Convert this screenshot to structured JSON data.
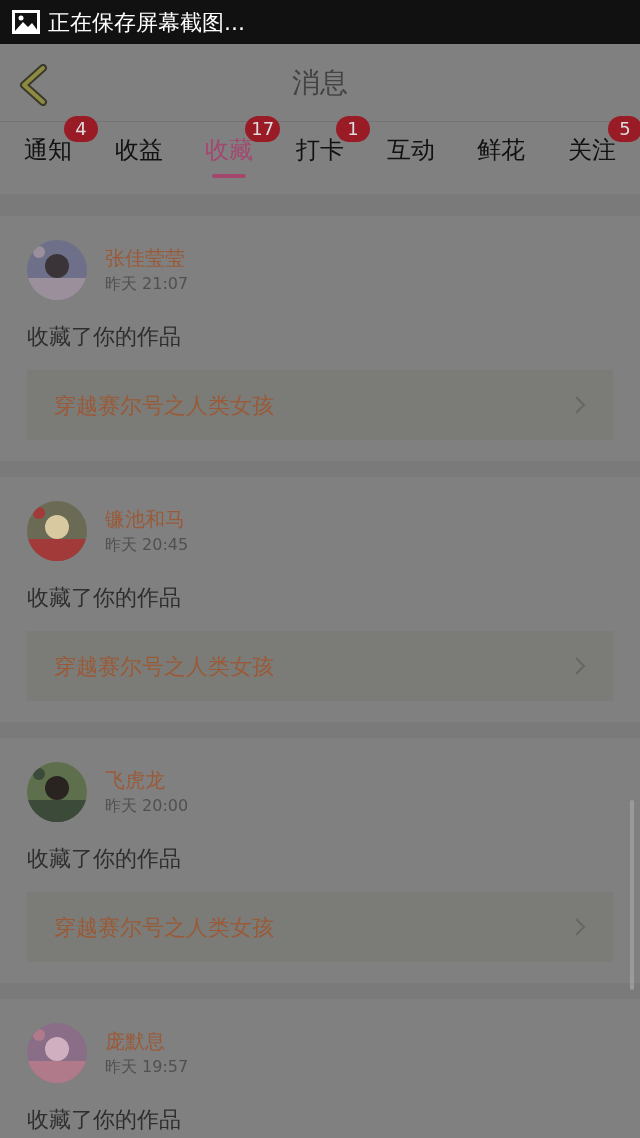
{
  "status_bar": {
    "text": "正在保存屏幕截图..."
  },
  "header": {
    "title": "消息"
  },
  "tabs": [
    {
      "label": "通知",
      "badge": "4",
      "selected": false
    },
    {
      "label": "收益",
      "selected": false
    },
    {
      "label": "收藏",
      "badge": "17",
      "selected": true
    },
    {
      "label": "打卡",
      "badge": "1",
      "selected": false
    },
    {
      "label": "互动",
      "selected": false
    },
    {
      "label": "鲜花",
      "selected": false
    },
    {
      "label": "关注",
      "badge": "5",
      "selected": false
    }
  ],
  "messages": [
    {
      "name": "张佳莹莹",
      "time": "昨天 21:07",
      "action": "收藏了你的作品",
      "work": "穿越赛尔号之人类女孩"
    },
    {
      "name": "镰池和马",
      "time": "昨天 20:45",
      "action": "收藏了你的作品",
      "work": "穿越赛尔号之人类女孩"
    },
    {
      "name": "飞虎龙",
      "time": "昨天 20:00",
      "action": "收藏了你的作品",
      "work": "穿越赛尔号之人类女孩"
    },
    {
      "name": "庞默息",
      "time": "昨天 19:57",
      "action": "收藏了你的作品"
    }
  ]
}
